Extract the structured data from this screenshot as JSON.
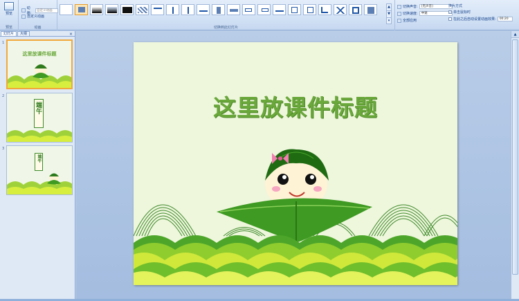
{
  "ribbon": {
    "preview_label": "预览",
    "anim_label": "动画:",
    "anim_placeholder": "自定义动画",
    "custom_anim_label": "自定义动画",
    "group_preview": "预览",
    "group_anim": "动画",
    "group_transition": "切换到此幻灯片",
    "transition_sound_label": "切换声音:",
    "transition_sound_value": "[无声音]",
    "transition_speed_label": "切换速度:",
    "transition_speed_value": "中速",
    "apply_all_label": "全部应用",
    "advance_title": "换片方式",
    "on_click_label": "单击鼠标时",
    "auto_label": "在此之后自动设置动画效果:",
    "auto_time": "00:20"
  },
  "left": {
    "tab_slides": "幻灯片",
    "tab_outline": "大纲",
    "close": "×",
    "slides": [
      {
        "num": "1",
        "title": "这里放课件标题"
      },
      {
        "num": "2",
        "title": "端午"
      },
      {
        "num": "3",
        "title": "端午"
      }
    ]
  },
  "slide": {
    "title": "这里放课件标题"
  },
  "colors": {
    "title_green": "#6aa83b",
    "accent_orange": "#f2a83a"
  }
}
